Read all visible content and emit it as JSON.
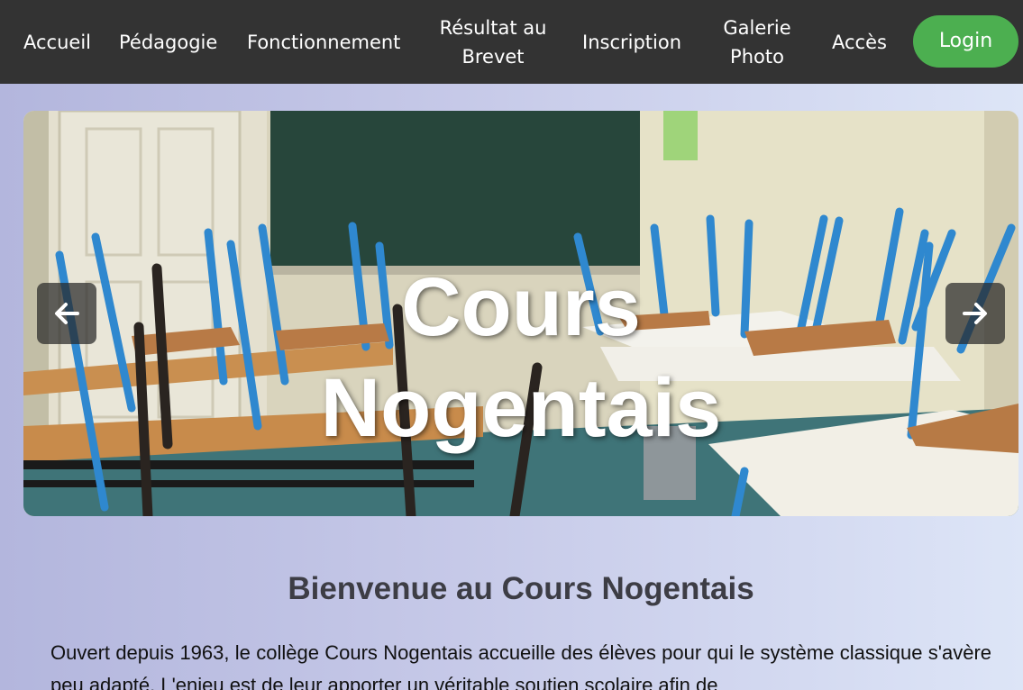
{
  "nav": {
    "items": [
      {
        "label": "Accueil"
      },
      {
        "label": "Pédagogie"
      },
      {
        "label": "Fonctionnement"
      },
      {
        "label": "Résultat au Brevet"
      },
      {
        "label": "Inscription"
      },
      {
        "label": "Galerie Photo"
      },
      {
        "label": "Accès"
      }
    ],
    "login_label": "Login"
  },
  "hero": {
    "title_line1": "Cours",
    "title_line2": "Nogentais",
    "prev_icon": "arrow-left-icon",
    "next_icon": "arrow-right-icon"
  },
  "content": {
    "welcome_title": "Bienvenue au Cours Nogentais",
    "intro_text": "Ouvert depuis 1963, le collège Cours Nogentais accueille des élèves pour qui le système classique s'avère peu adapté. L'enjeu est de leur apporter un véritable soutien scolaire afin de"
  },
  "colors": {
    "navbar": "#333333",
    "login": "#4caf50",
    "title_text": "#3d3d45"
  }
}
